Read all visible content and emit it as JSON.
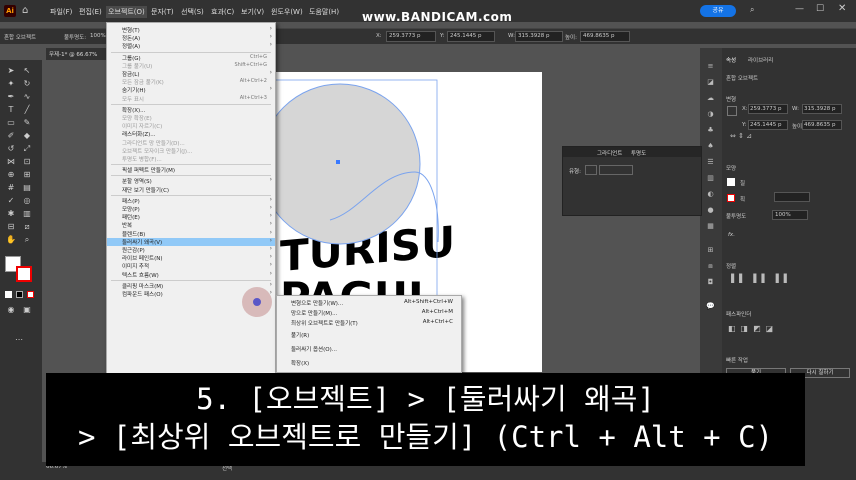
{
  "menubar": {
    "logo": "Ai",
    "items": [
      "파일(F)",
      "편집(E)",
      "오브젝트(O)",
      "문자(T)",
      "선택(S)",
      "효과(C)",
      "보기(V)",
      "윈도우(W)",
      "도움말(H)"
    ],
    "share_label": "공유",
    "watermark": "www.BANDICAM.com"
  },
  "control_bar": {
    "object_type": "혼합 오브젝트",
    "opacity_label": "불투명도:",
    "opacity_value": "100%",
    "x_label": "X:",
    "x_value": "259.3773 p",
    "y_label": "Y:",
    "y_value": "245.1445 p",
    "w_label": "W:",
    "w_value": "315.3928 p",
    "h_label": "높이:",
    "h_value": "469.8635 p"
  },
  "document_tab": "무제-1* @ 66.67%",
  "object_menu": {
    "items": [
      {
        "label": "변형(T)",
        "shortcut": "",
        "arrow": true,
        "disabled": false
      },
      {
        "label": "정돈(A)",
        "shortcut": "",
        "arrow": true,
        "disabled": false
      },
      {
        "label": "정렬(A)",
        "shortcut": "",
        "arrow": true,
        "disabled": false
      },
      {
        "sep": true
      },
      {
        "label": "그룹(G)",
        "shortcut": "Ctrl+G",
        "arrow": false,
        "disabled": false
      },
      {
        "label": "그룹 풀기(U)",
        "shortcut": "Shift+Ctrl+G",
        "arrow": false,
        "disabled": true
      },
      {
        "label": "잠금(L)",
        "shortcut": "",
        "arrow": true,
        "disabled": false
      },
      {
        "label": "모든 잠금 풀기(K)",
        "shortcut": "Alt+Ctrl+2",
        "arrow": false,
        "disabled": true
      },
      {
        "label": "숨기기(H)",
        "shortcut": "",
        "arrow": true,
        "disabled": false
      },
      {
        "label": "모두 표시",
        "shortcut": "Alt+Ctrl+3",
        "arrow": false,
        "disabled": true
      },
      {
        "sep": true
      },
      {
        "label": "확장(X)...",
        "shortcut": "",
        "arrow": false,
        "disabled": false
      },
      {
        "label": "모양 확장(E)",
        "shortcut": "",
        "arrow": false,
        "disabled": true
      },
      {
        "label": "이미지 자르기(C)",
        "shortcut": "",
        "arrow": false,
        "disabled": true
      },
      {
        "label": "래스터화(Z)...",
        "shortcut": "",
        "arrow": false,
        "disabled": false
      },
      {
        "label": "그라디언트 망 만들기(D)...",
        "shortcut": "",
        "arrow": false,
        "disabled": true
      },
      {
        "label": "오브젝트 모자이크 만들기(J)...",
        "shortcut": "",
        "arrow": false,
        "disabled": true
      },
      {
        "label": "투명도 병합(F)...",
        "shortcut": "",
        "arrow": false,
        "disabled": true
      },
      {
        "sep": true
      },
      {
        "label": "픽셀 퍼펙트 만들기(M)",
        "shortcut": "",
        "arrow": false,
        "disabled": false
      },
      {
        "sep": true
      },
      {
        "label": "분할 영역(S)",
        "shortcut": "",
        "arrow": true,
        "disabled": false
      },
      {
        "label": "재단 보기 만들기(C)",
        "shortcut": "",
        "arrow": false,
        "disabled": false
      },
      {
        "sep": true
      },
      {
        "label": "패스(P)",
        "shortcut": "",
        "arrow": true,
        "disabled": false
      },
      {
        "label": "모양(P)",
        "shortcut": "",
        "arrow": true,
        "disabled": false
      },
      {
        "label": "패턴(E)",
        "shortcut": "",
        "arrow": true,
        "disabled": false
      },
      {
        "label": "반복",
        "shortcut": "",
        "arrow": true,
        "disabled": false
      },
      {
        "label": "블렌드(B)",
        "shortcut": "",
        "arrow": true,
        "disabled": false
      },
      {
        "label": "둘러싸기 왜곡(V)",
        "shortcut": "",
        "arrow": true,
        "disabled": false,
        "highlight": true
      },
      {
        "label": "원근감(P)",
        "shortcut": "",
        "arrow": true,
        "disabled": false
      },
      {
        "label": "라이브 페인트(N)",
        "shortcut": "",
        "arrow": true,
        "disabled": false
      },
      {
        "label": "이미지 추적",
        "shortcut": "",
        "arrow": true,
        "disabled": false
      },
      {
        "label": "텍스트 흐름(W)",
        "shortcut": "",
        "arrow": true,
        "disabled": false
      },
      {
        "sep": true
      },
      {
        "label": "클리핑 마스크(M)",
        "shortcut": "",
        "arrow": true,
        "disabled": false
      },
      {
        "label": "컴파운드 패스(O)",
        "shortcut": "",
        "arrow": true,
        "disabled": false
      }
    ]
  },
  "envelope_submenu": {
    "items": [
      {
        "label": "변형으로 만들기(W)...",
        "shortcut": "Alt+Shift+Ctrl+W"
      },
      {
        "label": "망으로 만들기(M)...",
        "shortcut": "Alt+Ctrl+M"
      },
      {
        "label": "최상위 오브젝트로 만들기(T)",
        "shortcut": "Alt+Ctrl+C"
      },
      {
        "label": "풀기(R)",
        "shortcut": ""
      },
      {
        "label": "둘러싸기 옵션(O)...",
        "shortcut": ""
      },
      {
        "label": "확장(X)",
        "shortcut": ""
      }
    ]
  },
  "right_panel": {
    "tabs": [
      "속성",
      "라이브러리"
    ],
    "object_type": "혼합 오브젝트",
    "transform_label": "변형",
    "x_label": "X:",
    "x_value": "259.3773 p",
    "y_label": "Y:",
    "y_value": "245.1445 p",
    "w_label": "W:",
    "w_value": "315.3928 p",
    "h_label": "높이:",
    "h_value": "469.8635 p",
    "appearance_label": "모양",
    "fill_label": "칠",
    "stroke_label": "획",
    "opacity_label": "불투명도",
    "opacity_value": "100%",
    "fx_label": "fx.",
    "align_label": "정렬",
    "pathfinder_label": "패스파인더",
    "quick_actions_label": "빠른 작업",
    "release_button": "풀기",
    "reedit_button": "다시 칠하기"
  },
  "gradient_panel": {
    "tabs": [
      "그라디언트",
      "투명도"
    ],
    "type_label": "유형:"
  },
  "artwork_text": "TURISU\nPAGUL",
  "status_bar": {
    "zoom": "66.67%",
    "tool": "선택"
  },
  "caption": {
    "line1": "5. [오브젝트] > [둘러싸기 왜곡]",
    "line2": "> [최상위 오브젝트로 만들기] (Ctrl + Alt + C)"
  },
  "colors": {
    "accent": "#1473e6",
    "highlight": "#91c9f7",
    "bg": "#535353",
    "panel": "#323232"
  }
}
